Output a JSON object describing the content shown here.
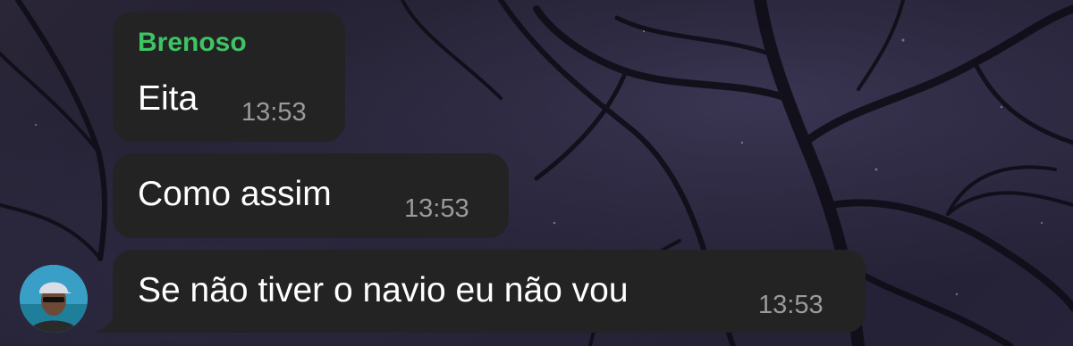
{
  "chat": {
    "messages": [
      {
        "sender": "Brenoso",
        "text": "Eita",
        "time": "13:53"
      },
      {
        "text": "Como assim",
        "time": "13:53"
      },
      {
        "text": "Se não tiver o navio eu não vou",
        "time": "13:53"
      }
    ],
    "sender_color": "#3ec464",
    "bubble_color": "#232323",
    "avatar": "user-avatar-photo"
  }
}
